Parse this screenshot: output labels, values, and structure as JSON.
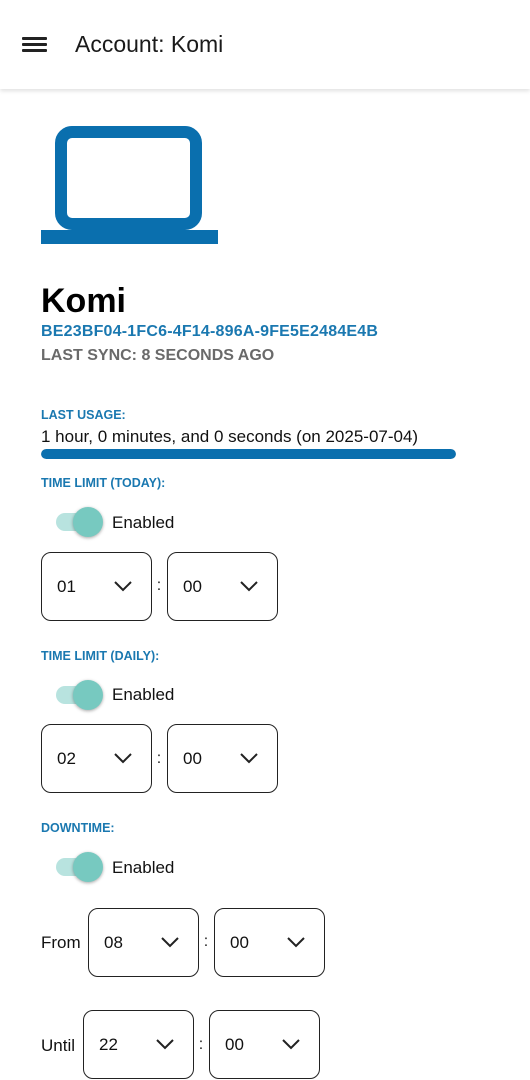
{
  "app_bar": {
    "title": "Account: Komi",
    "menu_icon": "hamburger-menu-icon"
  },
  "device": {
    "icon": "laptop-icon",
    "icon_color": "#0a6fae",
    "name": "Komi",
    "id": "BE23BF04-1FC6-4F14-896A-9FE5E2484E4B",
    "last_sync": "LAST SYNC: 8 SECONDS AGO"
  },
  "last_usage": {
    "label": "LAST USAGE:",
    "text": "1 hour, 0 minutes, and 0 seconds (on 2025-07-04)",
    "progress_fraction": 1.0
  },
  "time_limit_today": {
    "label": "TIME LIMIT (TODAY):",
    "toggle_label": "Enabled",
    "enabled": true,
    "hours": "01",
    "minutes": "00"
  },
  "time_limit_daily": {
    "label": "TIME LIMIT (DAILY):",
    "toggle_label": "Enabled",
    "enabled": true,
    "hours": "02",
    "minutes": "00"
  },
  "downtime": {
    "label": "DOWNTIME:",
    "toggle_label": "Enabled",
    "enabled": true,
    "from_label": "From",
    "from_hours": "08",
    "from_minutes": "00",
    "until_label": "Until",
    "until_hours": "22",
    "until_minutes": "00"
  },
  "colon": ":",
  "colors": {
    "accent_blue": "#1a78b0",
    "toggle_thumb": "#77c9c0",
    "toggle_track": "#b8e3df",
    "progress": "#0a6fae"
  }
}
